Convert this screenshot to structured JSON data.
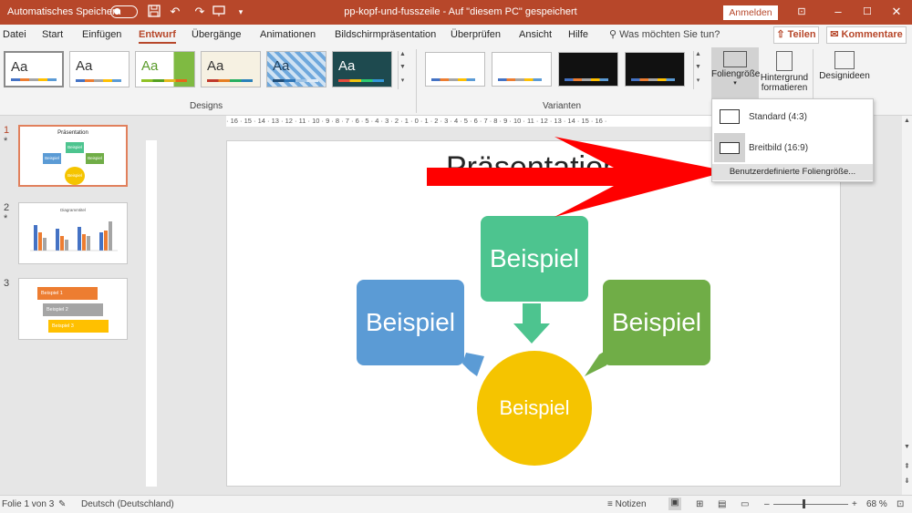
{
  "titlebar": {
    "autosave_label": "Automatisches Speichern",
    "title": "pp-kopf-und-fusszeile  -  Auf \"diesem PC\" gespeichert",
    "signin": "Anmelden",
    "icons": [
      "save-icon",
      "undo-icon",
      "redo-icon",
      "present-icon",
      "customize-icon"
    ]
  },
  "tabs": [
    "Datei",
    "Start",
    "Einfügen",
    "Entwurf",
    "Übergänge",
    "Animationen",
    "Bildschirmpräsentation",
    "Überprüfen",
    "Ansicht",
    "Hilfe"
  ],
  "active_tab": "Entwurf",
  "tellme": "Was möchten Sie tun?",
  "share": "Teilen",
  "comments": "Kommentare",
  "ribbon": {
    "themes_label": "Aa",
    "designs_group": "Designs",
    "variants_group": "Varianten",
    "slide_size_label": "Foliengröße",
    "background_label_1": "Hintergrund",
    "background_label_2": "formatieren",
    "designer_label": "Designideen"
  },
  "slide_size_menu": {
    "standard": "Standard (4:3)",
    "widescreen": "Breitbild (16:9)",
    "custom": "Benutzerdefinierte Foliengröße..."
  },
  "thumbnails": {
    "slide1_num": "1",
    "slide1_title": "Präsentation",
    "slide1_label": "Beispiel",
    "slide2_num": "2",
    "slide2_title": "Diagrammtitel",
    "slide3_num": "3",
    "slide3_items": [
      "Beispiel 1",
      "Beispiel 2",
      "Beispiel 3"
    ]
  },
  "ruler_text": "· 16 · 15 · 14 · 13 · 12 · 11 · 10 · 9 · 8 · 7 · 6 · 5 · 4 · 3 · 2 · 1 · 0 · 1 · 2 · 3 · 4 · 5 · 6 · 7 · 8 · 9 · 10 · 11 · 12 · 13 · 14 · 15 · 16 ·",
  "slide": {
    "title": "Präsentation",
    "box_top": "Beispiel",
    "box_left": "Beispiel",
    "box_right": "Beispiel",
    "circle": "Beispiel"
  },
  "colors": {
    "accent": "#b7472a",
    "green_box": "#4dc48f",
    "blue_box": "#5b9bd5",
    "dark_green_box": "#70ad47",
    "circle": "#f5c400",
    "arrow": "#ff0000"
  },
  "status": {
    "slide_info": "Folie 1 von 3",
    "language": "Deutsch (Deutschland)",
    "notes": "Notizen",
    "zoom": "68 %"
  }
}
